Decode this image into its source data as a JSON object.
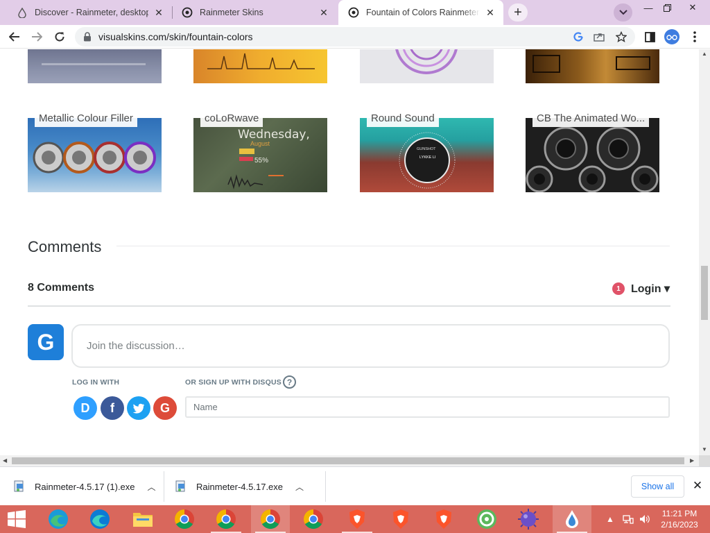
{
  "browser": {
    "tabs": [
      {
        "title": "Discover - Rainmeter, desktop cu",
        "active": false
      },
      {
        "title": "Rainmeter Skins",
        "active": false
      },
      {
        "title": "Fountain of Colors Rainmeter Skins",
        "active": true
      }
    ],
    "url": "visualskins.com/skin/fountain-colors"
  },
  "gallery": {
    "row2": [
      {
        "label": "Metallic Colour Filler"
      },
      {
        "label": "coLoRwave"
      },
      {
        "label": "Round Sound"
      },
      {
        "label": "CB The Animated Wo..."
      }
    ],
    "thumb_text": {
      "colorwave_day": "Wednesday,",
      "colorwave_month": "August",
      "colorwave_percent": "55%",
      "roundsound_track": "GUNSHOT",
      "roundsound_artist": "LYKKE LI"
    }
  },
  "comments": {
    "heading": "Comments",
    "count": "8 Comments",
    "notification_count": "1",
    "login_label": "Login ▾",
    "avatar_letter": "G",
    "discussion_placeholder": "Join the discussion…",
    "log_in_with": "LOG IN WITH",
    "or_sign_up": "OR SIGN UP WITH DISQUS",
    "help_symbol": "?",
    "social": [
      {
        "letter": "D",
        "color": "#2e9fff"
      },
      {
        "letter": "f",
        "color": "#3b5999"
      },
      {
        "letter": "t",
        "color": "#1da1f2"
      },
      {
        "letter": "G",
        "color": "#dd4b39"
      }
    ],
    "name_placeholder": "Name"
  },
  "downloads": {
    "items": [
      {
        "filename": "Rainmeter-4.5.17 (1).exe"
      },
      {
        "filename": "Rainmeter-4.5.17.exe"
      }
    ],
    "show_all": "Show all"
  },
  "taskbar": {
    "time": "11:21 PM",
    "date": "2/16/2023",
    "accent": "#d9675c"
  }
}
